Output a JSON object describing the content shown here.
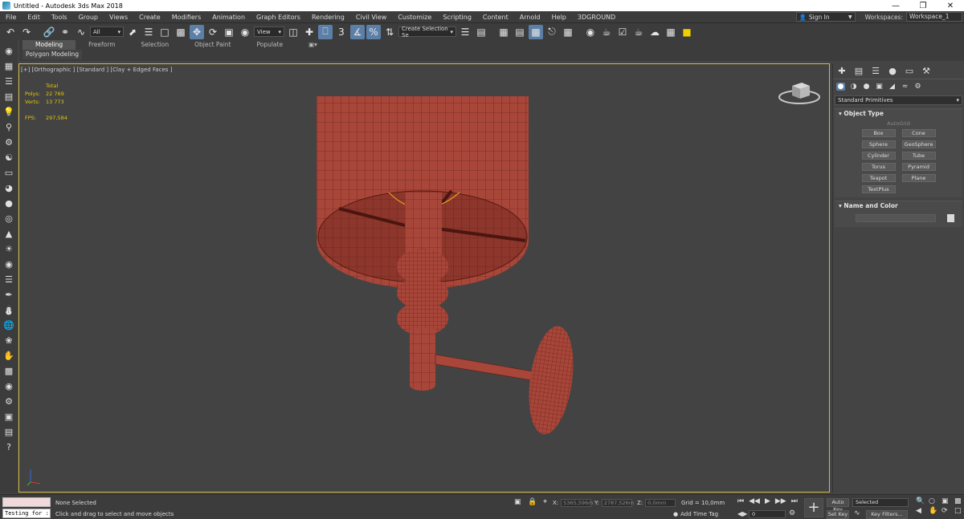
{
  "window": {
    "title": "Untitled - Autodesk 3ds Max 2018"
  },
  "menu": {
    "items": [
      "File",
      "Edit",
      "Tools",
      "Group",
      "Views",
      "Create",
      "Modifiers",
      "Animation",
      "Graph Editors",
      "Rendering",
      "Civil View",
      "Customize",
      "Scripting",
      "Content",
      "Arnold",
      "Help",
      "3DGROUND"
    ],
    "sign_in": "Sign In",
    "workspaces_label": "Workspaces:",
    "workspace": "Workspace_1"
  },
  "toolbar": {
    "selection_filter": "All",
    "ref_coord": "View",
    "snap_value": "3",
    "named_selection": "Create Selection Se"
  },
  "ribbon": {
    "tabs": [
      "Modeling",
      "Freeform",
      "Selection",
      "Object Paint",
      "Populate"
    ],
    "active_tab": "Modeling",
    "subpanel": "Polygon Modeling"
  },
  "viewport": {
    "label": "[+] [Orthographic ] [Standard ] [Clay + Edged Faces ]",
    "stats": {
      "header": "Total",
      "polys_label": "Polys:",
      "polys": "22 769",
      "verts_label": "Verts:",
      "verts": "13 773",
      "fps_label": "FPS:",
      "fps": "297,584"
    }
  },
  "command_panel": {
    "category": "Standard Primitives",
    "object_type_title": "Object Type",
    "autogrid": "AutoGrid",
    "objects": [
      "Box",
      "Cone",
      "Sphere",
      "GeoSphere",
      "Cylinder",
      "Tube",
      "Torus",
      "Pyramid",
      "Teapot",
      "Plane",
      "TextPlus"
    ],
    "name_color_title": "Name and Color"
  },
  "status": {
    "maxscript_text": "Testing for :",
    "selection": "None Selected",
    "prompt": "Click and drag to select and move objects",
    "x_label": "X:",
    "x": "5365,596m",
    "y_label": "Y:",
    "y": "2787,526m",
    "z_label": "Z:",
    "z": "0,0mm",
    "grid": "Grid = 10,0mm",
    "add_time_tag": "Add Time Tag",
    "frame": "0",
    "auto_key": "Auto Key",
    "set_key": "Set Key",
    "selected": "Selected",
    "key_filters": "Key Filters..."
  }
}
